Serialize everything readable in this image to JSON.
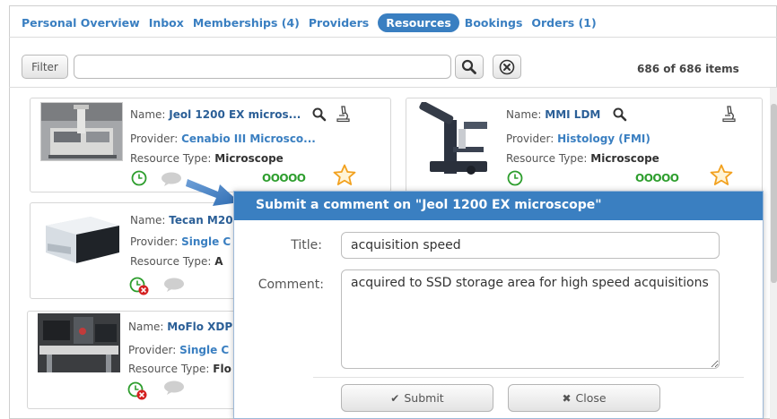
{
  "tabs": [
    {
      "label": "Personal Overview",
      "active": false
    },
    {
      "label": "Inbox",
      "active": false
    },
    {
      "label": "Memberships (4)",
      "active": false
    },
    {
      "label": "Providers",
      "active": false
    },
    {
      "label": "Resources",
      "active": true
    },
    {
      "label": "Bookings",
      "active": false
    },
    {
      "label": "Orders (1)",
      "active": false
    }
  ],
  "filter": {
    "button_label": "Filter",
    "value": "",
    "count_text": "686 of 686 items"
  },
  "labels": {
    "name": "Name: ",
    "provider": "Provider: ",
    "resource_type": "Resource Type: "
  },
  "resources": [
    {
      "name": "Jeol 1200 EX micros...",
      "provider": "Cenabio III Microsco...",
      "type": "Microscope",
      "rating_text": "OOOOO",
      "status": "available"
    },
    {
      "name": "MMI LDM",
      "provider": "Histology (FMI)",
      "type": "Microscope",
      "rating_text": "OOOOO",
      "status": "available"
    },
    {
      "name": "Tecan M20",
      "provider": "Single C",
      "type": "A",
      "status": "unavailable"
    },
    {
      "name": "MoFlo XDP",
      "provider": "Single C",
      "type": "Flo",
      "status": "unavailable"
    }
  ],
  "dialog": {
    "title": "Submit a comment on \"Jeol 1200 EX microscope\"",
    "title_label": "Title:",
    "title_value": "acquisition speed",
    "comment_label": "Comment:",
    "comment_value": "acquired to SSD storage area for high speed acquisitions",
    "submit_label": "Submit",
    "close_label": "Close"
  },
  "colors": {
    "accent": "#3a7fc1",
    "available": "#2e9e2e",
    "unavailable": "#d42020",
    "star": "#f2a11f"
  }
}
